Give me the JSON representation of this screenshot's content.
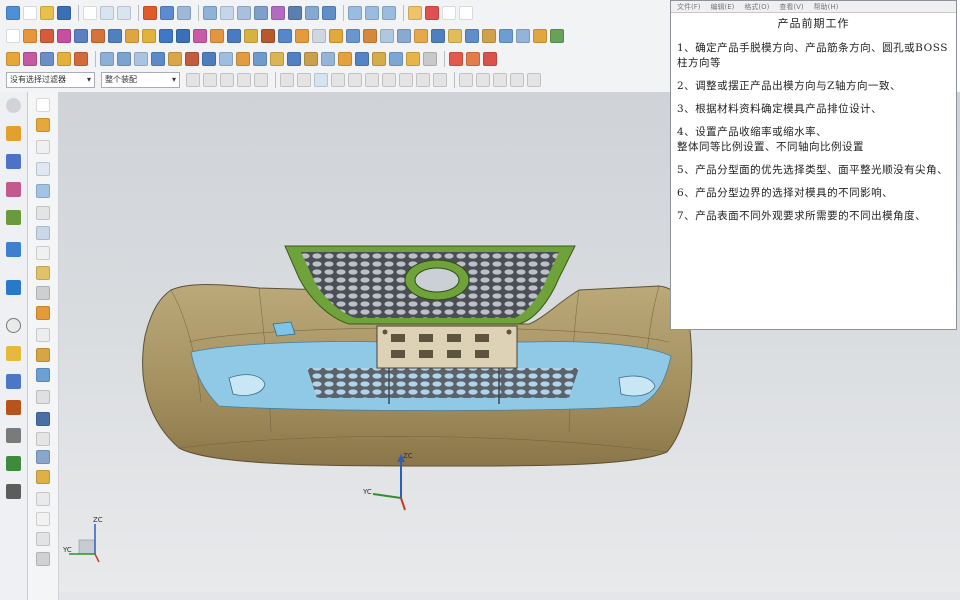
{
  "toolbar": {
    "selection_filter": "没有选择过滤器",
    "assembly_scope": "整个装配"
  },
  "notes_window": {
    "menu": [
      "文件(F)",
      "编辑(E)",
      "格式(O)",
      "查看(V)",
      "帮助(H)"
    ],
    "title": "产品前期工作",
    "items": [
      {
        "number": "1、",
        "text": "确定产品手脱模方向、产品筋条方向、圆孔或BOSS柱方向等"
      },
      {
        "number": "2、",
        "text": "调整或摆正产品出模方向与Z轴方向一致、"
      },
      {
        "number": "3、",
        "text": "根据材料资料确定模具产品排位设计、"
      },
      {
        "number": "4、",
        "text": "设置产品收缩率或缩水率、",
        "extra": "整体同等比例设置、不同轴向比例设置"
      },
      {
        "number": "5、",
        "text": "产品分型面的优先选择类型、面平整光顺没有尖角、"
      },
      {
        "number": "6、",
        "text": "产品分型边界的选择对模具的不同影响、"
      },
      {
        "number": "7、",
        "text": "产品表面不同外观要求所需要的不同出模角度、"
      }
    ]
  },
  "triad": {
    "x": "XC",
    "y": "YC",
    "z": "ZC"
  },
  "colors": {
    "part_body": "#a89668",
    "grille": "#6fa23a",
    "lower_surface": "#8fc9e6",
    "plate": "#ddd2b6",
    "viewport_top": "#cfd3d8",
    "viewport_bottom": "#e9eaec"
  }
}
